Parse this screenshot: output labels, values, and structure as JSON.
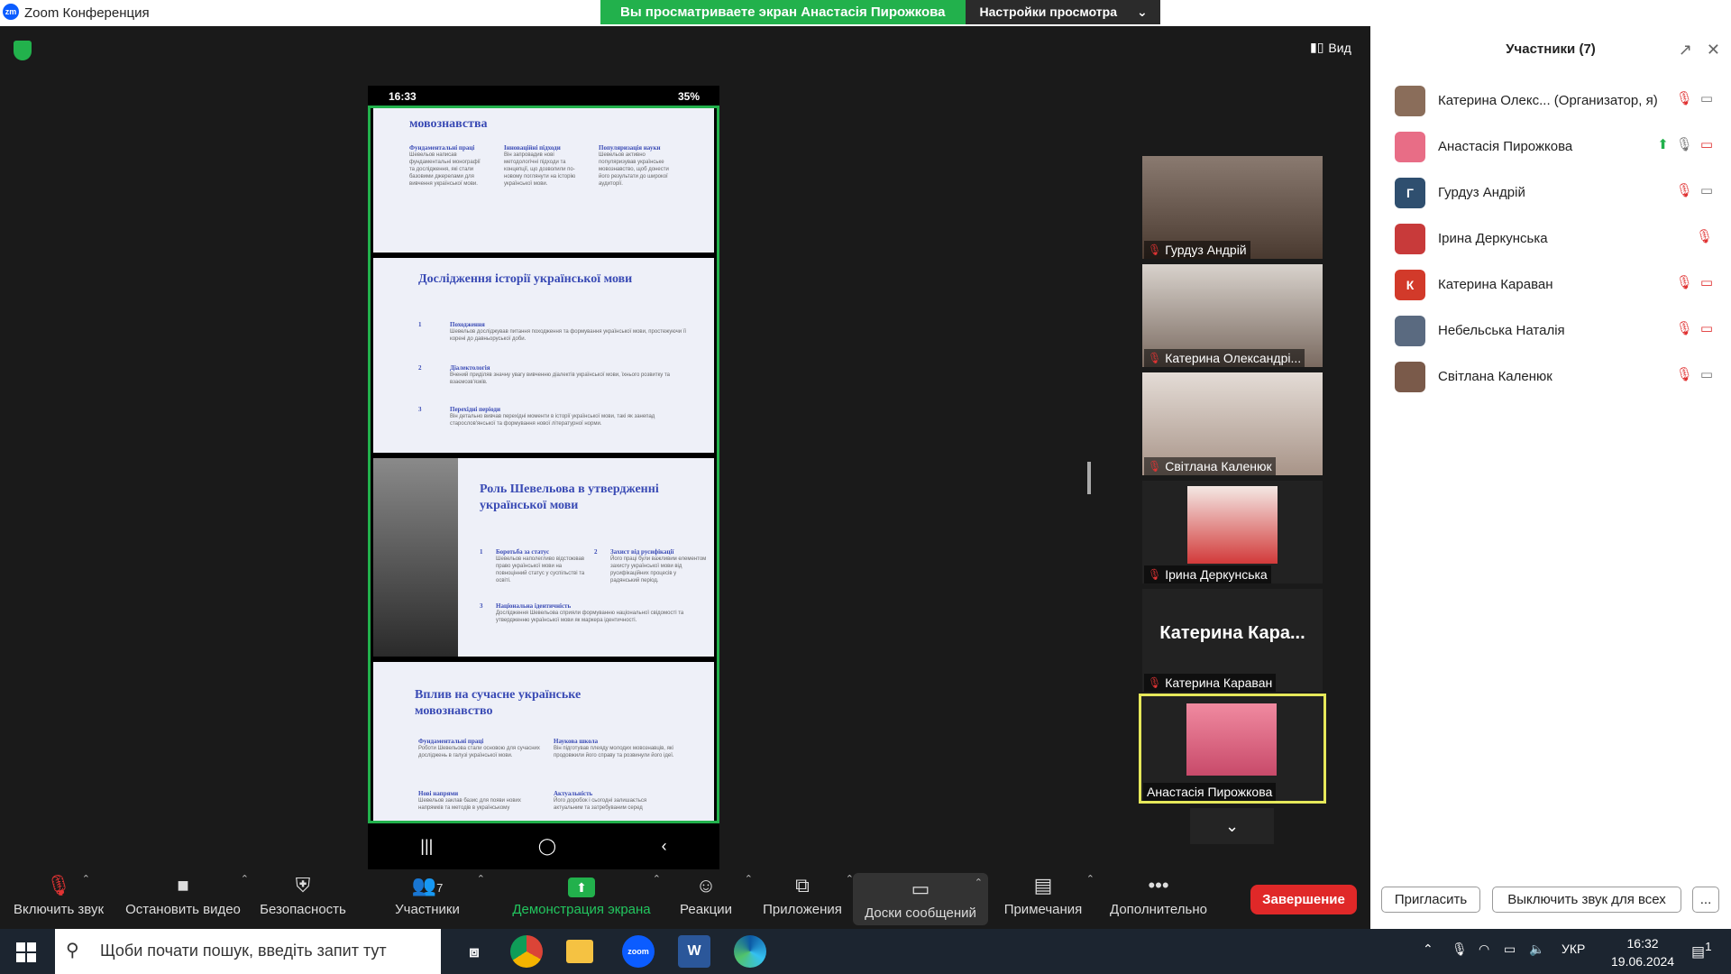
{
  "window": {
    "title": "Zoom Конференция",
    "logo": "zm"
  },
  "banner": {
    "viewing": "Вы просматриваете экран Анастасія Пирожкова",
    "settings": "Настройки просмотра"
  },
  "view_button": "Вид",
  "phone": {
    "time": "16:33",
    "battery": "35%",
    "slide1": {
      "title": "мовознавства",
      "cols": [
        {
          "label": "Фундаментальні праці",
          "text": "Шевельов написав фундаментальні монографії та дослідження, які стали базовими джерелами для вивчення української мови."
        },
        {
          "label": "Інноваційні підходи",
          "text": "Він запровадив нові методологічні підходи та концепції, що дозволили по-новому поглянути на історію української мови."
        },
        {
          "label": "Популяризація науки",
          "text": "Шевельов активно популяризував українське мовознавство, щоб донести його результати до широкої аудиторії."
        }
      ]
    },
    "slide2": {
      "title": "Дослідження історії української мови",
      "items": [
        {
          "num": "1",
          "label": "Походження",
          "text": "Шевельов досліджував питання походження та формування української мови, простежуючи її корені до давньоруської доби."
        },
        {
          "num": "2",
          "label": "Діалектологія",
          "text": "Вчений приділяв значну увагу вивченню діалектів української мови, їхнього розвитку та взаємозв'язків."
        },
        {
          "num": "3",
          "label": "Перехідні періоди",
          "text": "Він детально вивчав перехідні моменти в історії української мови, такі як занепад старослов'янської та формування нової літературної норми."
        }
      ]
    },
    "slide3": {
      "title": "Роль Шевельова в утвердженні української мови",
      "items": [
        {
          "num": "1",
          "label": "Боротьба за статус",
          "text": "Шевельов наполегливо відстоював право української мови на повноцінний статус у суспільстві та освіті."
        },
        {
          "num": "2",
          "label": "Захист від русифікації",
          "text": "Його праці були важливим елементом захисту української мови від русифікаційних процесів у радянський період."
        },
        {
          "num": "3",
          "label": "Національна ідентичність",
          "text": "Дослідження Шевельова сприяли формуванню національної свідомості та утвердженню української мови як маркера ідентичності."
        }
      ]
    },
    "slide4": {
      "title": "Вплив на сучасне українське мовознавство",
      "items": [
        {
          "label": "Фундаментальні праці",
          "text": "Роботи Шевельова стали основою для сучасних досліджень в галузі української мови."
        },
        {
          "label": "Наукова школа",
          "text": "Він підготував плеяду молодих мовознавців, які продовжили його справу та розвинули його ідеї."
        },
        {
          "label": "Нові напрями",
          "text": "Шевельов заклав базис для появи нових напрямків та методів в українському"
        },
        {
          "label": "Актуальність",
          "text": "Його доробок і сьогодні залишається актуальним та затребуваним серед"
        }
      ]
    }
  },
  "thumbnails": [
    {
      "name": "Гурдуз Андрій",
      "muted": true,
      "bg": "#6b5a4e"
    },
    {
      "name": "Катерина Олександрі...",
      "muted": true,
      "bg": "#a9a29c"
    },
    {
      "name": "Світлана Каленюк",
      "muted": true,
      "bg": "#c9bdb5"
    },
    {
      "name": "Ірина Деркунська",
      "muted": true,
      "bg": "#d23a3a"
    },
    {
      "name": "Катерина Караван",
      "muted": true,
      "bg": "#222222",
      "big": "Катерина  Кара..."
    },
    {
      "name": "Анастасія Пирожкова",
      "muted": false,
      "bg": "#e86d86"
    }
  ],
  "toolbar": {
    "mute": "Включить звук",
    "video": "Остановить видео",
    "security": "Безопасность",
    "participants": "Участники",
    "participants_count": "7",
    "share": "Демонстрация экрана",
    "reactions": "Реакции",
    "apps": "Приложения",
    "boards": "Доски сообщений",
    "notes": "Примечания",
    "more": "Дополнительно",
    "end": "Завершение"
  },
  "panel": {
    "title": "Участники (7)",
    "participants": [
      {
        "name": "Катерина Олекс...  (Организатор, я)",
        "initial": "",
        "color": "#8a6d5a"
      },
      {
        "name": "Анастасія Пирожкова",
        "initial": "",
        "color": "#e86d86"
      },
      {
        "name": "Гурдуз Андрій",
        "initial": "Г",
        "color": "#2f4f6f"
      },
      {
        "name": "Ірина Деркунська",
        "initial": "",
        "color": "#c83a3a"
      },
      {
        "name": "Катерина Караван",
        "initial": "К",
        "color": "#d23a2a"
      },
      {
        "name": "Небельська Наталія",
        "initial": "",
        "color": "#5a6a80"
      },
      {
        "name": "Світлана Каленюк",
        "initial": "",
        "color": "#7a5a4a"
      }
    ],
    "invite": "Пригласить",
    "mute_all": "Выключить звук для всех",
    "more": "..."
  },
  "taskbar": {
    "search_placeholder": "Щоби почати пошук, введіть запит тут",
    "lang": "УКР",
    "time": "16:32",
    "date": "19.06.2024",
    "notifications": "1"
  }
}
